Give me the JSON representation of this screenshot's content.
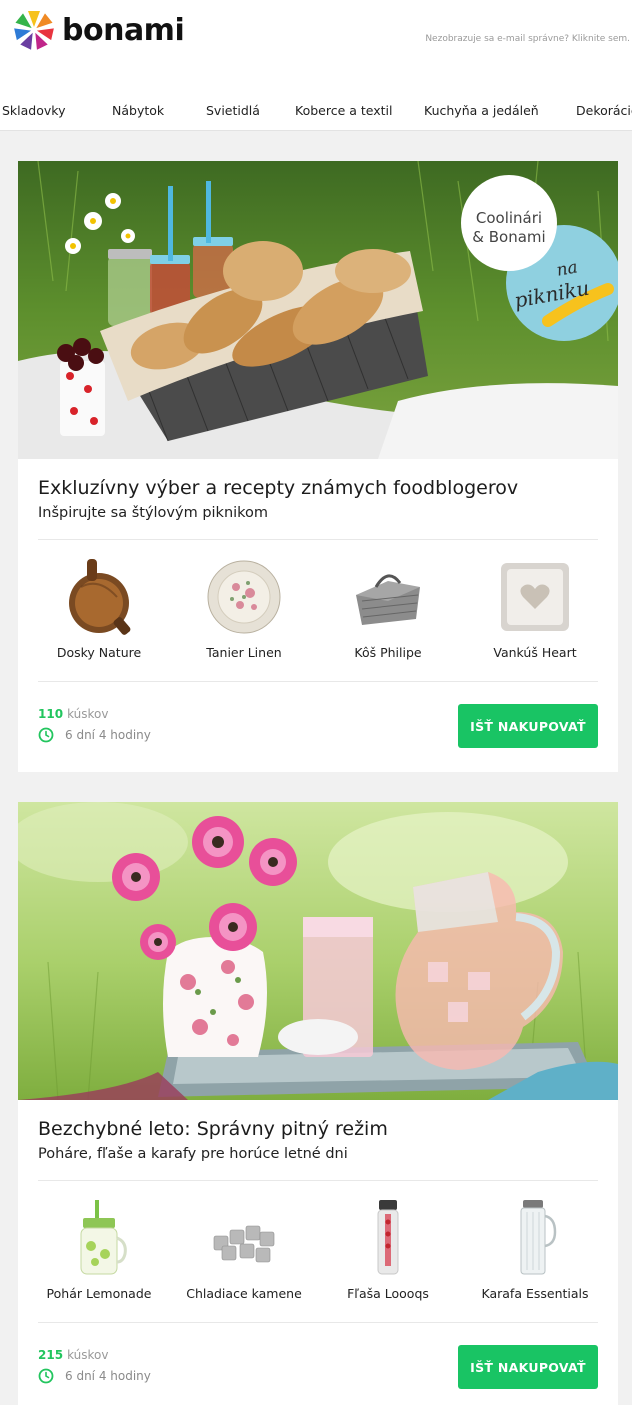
{
  "brand": {
    "name": "bonami"
  },
  "header": {
    "view_online": "Nezobrazuje sa e-mail správne? Kliknite sem."
  },
  "nav": {
    "items": [
      {
        "label": "Skladovky"
      },
      {
        "label": "Nábytok"
      },
      {
        "label": "Svietidlá"
      },
      {
        "label": "Koberce a textil"
      },
      {
        "label": "Kuchyňa a jedáleň"
      },
      {
        "label": "Dekorácie"
      }
    ]
  },
  "campaigns": [
    {
      "badge": {
        "line1": "Coolinári",
        "line2": "& Bonami",
        "script1": "na",
        "script2": "pikniku"
      },
      "title": "Exkluzívny výber a recepty známych foodblogerov",
      "subtitle": "Inšpirujte sa štýlovým piknikom",
      "products": [
        {
          "label": "Dosky Nature",
          "icon": "cutting-board-icon"
        },
        {
          "label": "Tanier Linen",
          "icon": "plate-icon"
        },
        {
          "label": "Kôš Philipe",
          "icon": "basket-icon"
        },
        {
          "label": "Vankúš Heart",
          "icon": "pillow-icon"
        }
      ],
      "count": "110",
      "count_unit": "kúskov",
      "time_left": "6 dní 4 hodiny",
      "cta": "IŠŤ NAKUPOVAŤ"
    },
    {
      "title": "Bezchybné leto: Správny pitný režim",
      "subtitle": "Poháre, fľaše a karafy pre horúce letné dni",
      "products": [
        {
          "label": "Pohár Lemonade",
          "icon": "mason-jar-icon"
        },
        {
          "label": "Chladiace kamene",
          "icon": "cooling-stones-icon"
        },
        {
          "label": "Fľaša Loooqs",
          "icon": "bottle-icon"
        },
        {
          "label": "Karafa Essentials",
          "icon": "carafe-icon"
        }
      ],
      "count": "215",
      "count_unit": "kúskov",
      "time_left": "6 dní 4 hodiny",
      "cta": "IŠŤ NAKUPOVAŤ"
    }
  ],
  "colors": {
    "accent": "#19c464",
    "count": "#22c55e",
    "background": "#f1f1f1"
  }
}
